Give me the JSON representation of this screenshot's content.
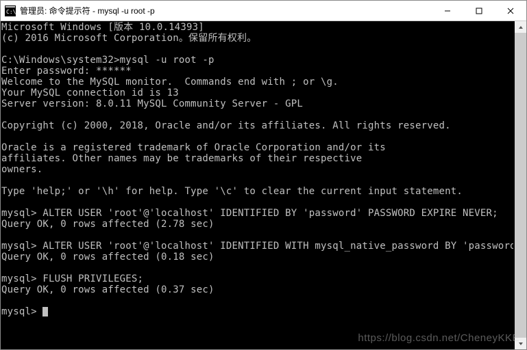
{
  "titlebar": {
    "title": "管理员: 命令提示符 - mysql  -u root -p"
  },
  "terminal": {
    "lines": [
      "Microsoft Windows [版本 10.0.14393]",
      "(c) 2016 Microsoft Corporation。保留所有权利。",
      "",
      "C:\\Windows\\system32>mysql -u root -p",
      "Enter password: ******",
      "Welcome to the MySQL monitor.  Commands end with ; or \\g.",
      "Your MySQL connection id is 13",
      "Server version: 8.0.11 MySQL Community Server - GPL",
      "",
      "Copyright (c) 2000, 2018, Oracle and/or its affiliates. All rights reserved.",
      "",
      "Oracle is a registered trademark of Oracle Corporation and/or its",
      "affiliates. Other names may be trademarks of their respective",
      "owners.",
      "",
      "Type 'help;' or '\\h' for help. Type '\\c' to clear the current input statement.",
      "",
      "mysql> ALTER USER 'root'@'localhost' IDENTIFIED BY 'password' PASSWORD EXPIRE NEVER;",
      "Query OK, 0 rows affected (2.78 sec)",
      "",
      "mysql> ALTER USER 'root'@'localhost' IDENTIFIED WITH mysql_native_password BY 'password';",
      "Query OK, 0 rows affected (0.18 sec)",
      "",
      "mysql> FLUSH PRIVILEGES;",
      "Query OK, 0 rows affected (0.37 sec)",
      "",
      "mysql> "
    ]
  },
  "watermark": "https://blog.csdn.net/CheneyKKE"
}
